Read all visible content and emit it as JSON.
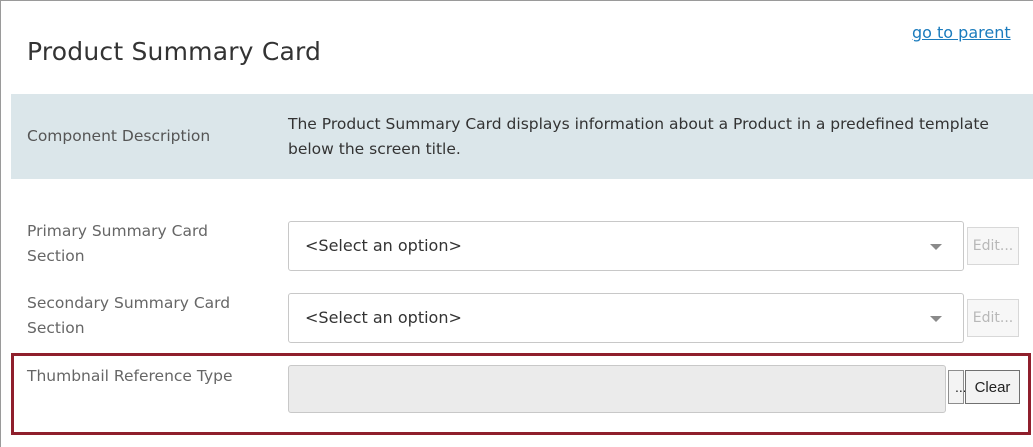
{
  "header": {
    "title": "Product Summary Card",
    "parent_link": "go to parent"
  },
  "description": {
    "label": "Component Description",
    "text": "The Product Summary Card displays information about a Product in a predefined template below the screen title."
  },
  "fields": {
    "primary": {
      "label": "Primary Summary Card Section",
      "value": "<Select an option>",
      "edit_label": "Edit..."
    },
    "secondary": {
      "label": "Secondary Summary Card Section",
      "value": "<Select an option>",
      "edit_label": "Edit..."
    },
    "thumbnail": {
      "label": "Thumbnail Reference Type",
      "value": "",
      "browse_label": "...",
      "clear_label": "Clear"
    }
  },
  "colors": {
    "link": "#1a7bbd",
    "description_background": "#dbe6ea",
    "highlight_border": "#8f1f2c",
    "disabled_input": "#ebebeb"
  },
  "icons": {
    "dropdown": "caret-down-icon"
  }
}
